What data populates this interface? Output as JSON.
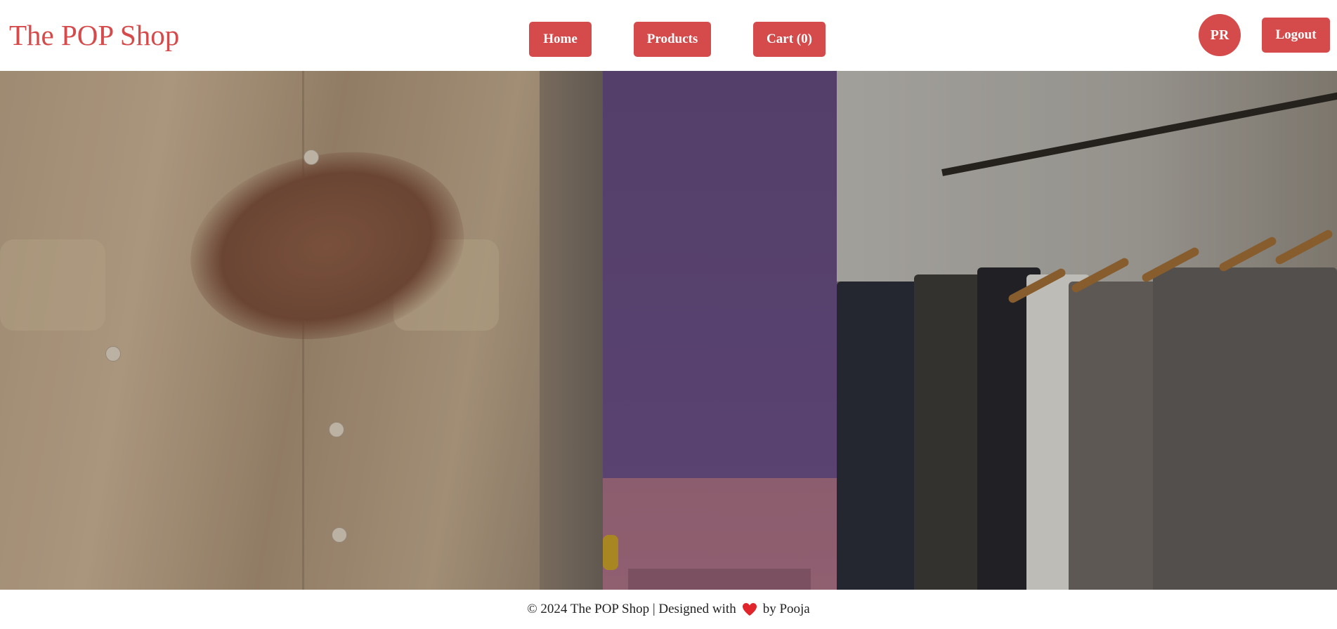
{
  "navbar": {
    "brand": "The POP Shop",
    "links": {
      "home": "Home",
      "products": "Products",
      "cart": "Cart (0)"
    },
    "user_initials": "PR",
    "logout": "Logout"
  },
  "hero": {
    "panels": [
      {
        "subject": "person in linen shirt adjusting rings"
      },
      {
        "subject": "purple wall with pink table"
      },
      {
        "subject": "clothing rack in store"
      }
    ]
  },
  "footer": {
    "text_before": "© 2024 The POP Shop | Designed with",
    "heart_icon": "heart-icon",
    "text_after": "by Pooja"
  },
  "colors": {
    "accent": "#d54a4a",
    "heart": "#e0262b"
  }
}
